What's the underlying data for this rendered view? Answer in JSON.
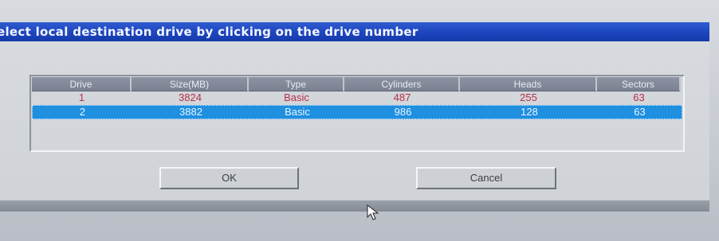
{
  "dialog": {
    "title": "elect local destination drive by clicking on the drive number"
  },
  "table": {
    "columns": [
      "Drive",
      "Size(MB)",
      "Type",
      "Cylinders",
      "Heads",
      "Sectors"
    ],
    "rows": [
      [
        "1",
        "3824",
        "Basic",
        "487",
        "255",
        "63"
      ],
      [
        "2",
        "3882",
        "Basic",
        "986",
        "128",
        "63"
      ]
    ],
    "selected_row": 2
  },
  "buttons": {
    "ok": "OK",
    "cancel": "Cancel"
  },
  "icons": {
    "cursor": "mouse-pointer-icon"
  },
  "colors": {
    "title_bar": "#1c45bf",
    "selection": "#1f8fe0",
    "row_text": "#b5314a"
  }
}
